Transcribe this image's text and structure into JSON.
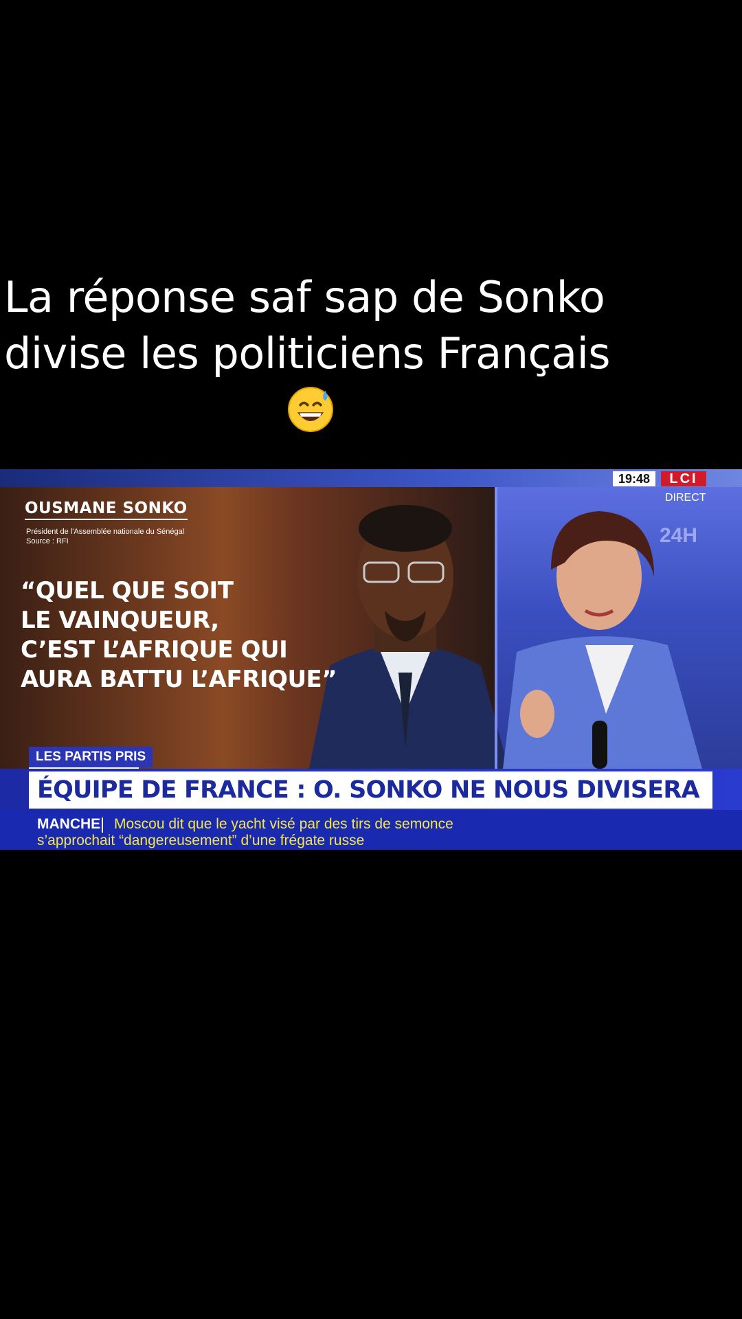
{
  "caption": {
    "line1": "La réponse saf sap de Sonko",
    "line2": "divise les politiciens Français",
    "emoji_icon": "grinning-face-with-sweat-emoji"
  },
  "broadcast": {
    "clock": "19:48",
    "channel_logo": "LCI",
    "live_label": "DIRECT",
    "badge": "24H",
    "speaker_name": "OUSMANE SONKO",
    "speaker_role": "Président de l'Assemblée nationale du Sénégal",
    "speaker_source": "Source : RFI",
    "quote": "“QUEL QUE SOIT\nLE VAINQUEUR,\nC’EST L’AFRIQUE QUI\nAURA BATTU L’AFRIQUE”",
    "segment_tag": "LES PARTIS PRIS",
    "headline": "ÉQUIPE DE FRANCE : O. SONKO NE NOUS DIVISERA PAS",
    "ticker_label": "MANCHE",
    "ticker_line1": "Moscou dit que le yacht visé par des tirs de semonce",
    "ticker_line2": "s’approchait “dangereusement” d’une frégate russe"
  },
  "colors": {
    "background": "#000000",
    "lci_red": "#d11b2a",
    "headline_blue": "#1b2a9c",
    "ticker_yellow": "#f4e64a"
  }
}
